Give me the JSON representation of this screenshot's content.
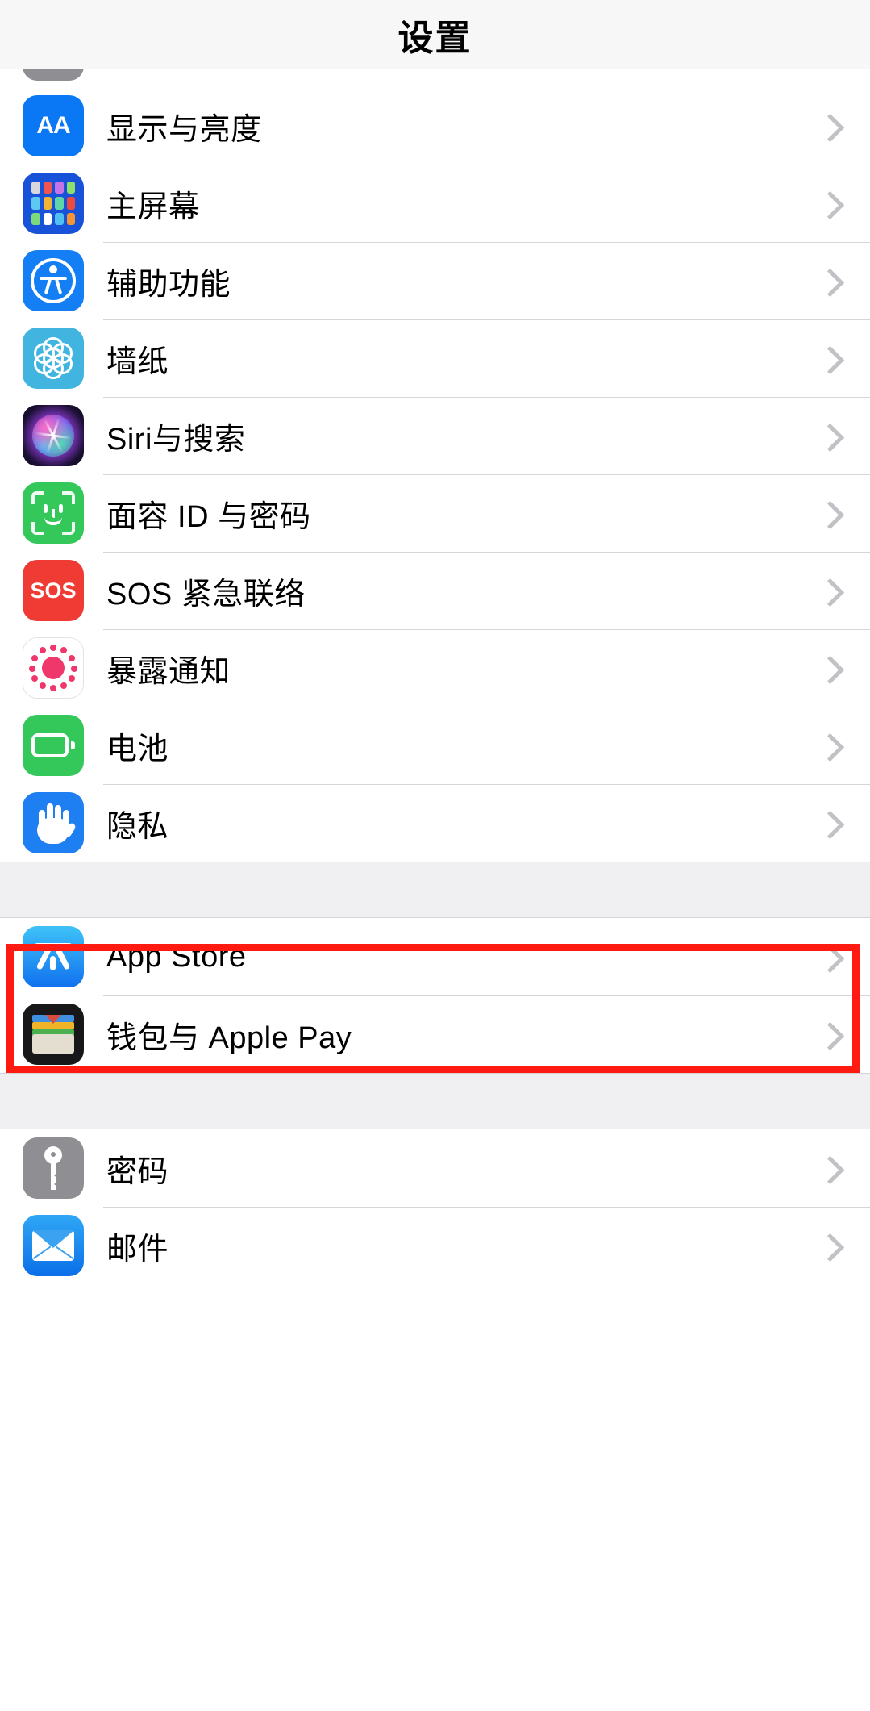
{
  "navbar": {
    "title": "设置"
  },
  "sections": [
    {
      "id": "system",
      "rows": [
        {
          "label": "显示与亮度",
          "icon": "display-brightness-icon"
        },
        {
          "label": "主屏幕",
          "icon": "home-screen-icon"
        },
        {
          "label": "辅助功能",
          "icon": "accessibility-icon"
        },
        {
          "label": "墙纸",
          "icon": "wallpaper-icon"
        },
        {
          "label": "Siri与搜索",
          "icon": "siri-icon"
        },
        {
          "label": "面容 ID 与密码",
          "icon": "face-id-icon"
        },
        {
          "label": "SOS 紧急联络",
          "icon": "sos-icon"
        },
        {
          "label": "暴露通知",
          "icon": "exposure-notifications-icon"
        },
        {
          "label": "电池",
          "icon": "battery-icon"
        },
        {
          "label": "隐私",
          "icon": "privacy-icon"
        }
      ]
    },
    {
      "id": "store",
      "rows": [
        {
          "label": "App Store",
          "icon": "app-store-icon"
        },
        {
          "label": "钱包与 Apple Pay",
          "icon": "wallet-icon"
        }
      ]
    },
    {
      "id": "accounts",
      "rows": [
        {
          "label": "密码",
          "icon": "passwords-key-icon"
        },
        {
          "label": "邮件",
          "icon": "mail-icon"
        }
      ]
    }
  ],
  "annotation": {
    "type": "highlight-rectangle",
    "color": "#ff1a12",
    "target_label": "电池"
  },
  "icon_colors": {
    "display_brightness": "#0a78f5",
    "home_screen": "#1752d8",
    "accessibility": "#147ef5",
    "wallpaper": "#41b5e0",
    "face_id": "#34c759",
    "sos": "#f03b34",
    "exposure_notifications": "#f0376b",
    "battery": "#34c759",
    "privacy": "#1d7ff2",
    "app_store": "#1071ef",
    "wallet": "#17171a",
    "passwords": "#8e8e93",
    "mail": "#0b6fe8"
  },
  "glyphs": {
    "aa": "AA",
    "sos": "SOS",
    "chevron": "›"
  }
}
